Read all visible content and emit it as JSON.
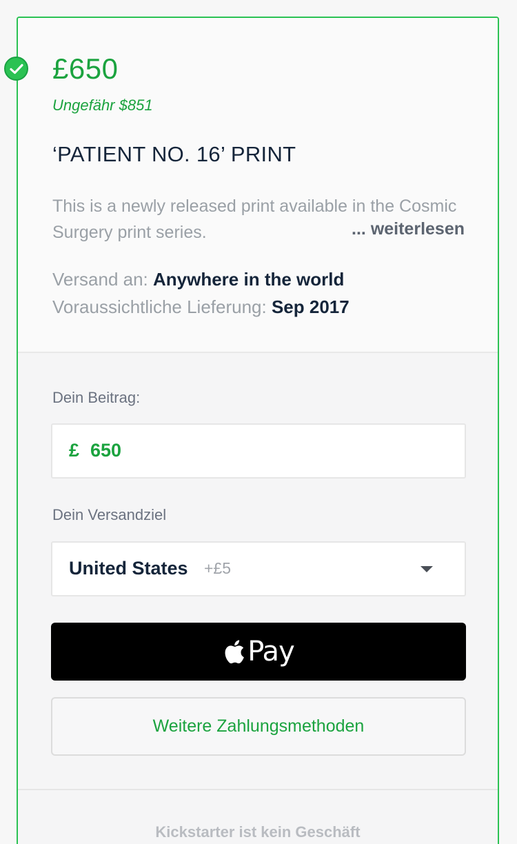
{
  "reward": {
    "price": "£650",
    "approx": "Ungefähr $851",
    "title": "‘PATIENT NO. 16’ PRINT",
    "description": "This is a newly released print available in the Cosmic Surgery print series.",
    "read_more": "... weiterlesen",
    "shipping_label": "Versand an: ",
    "shipping_value": "Anywhere in the world",
    "delivery_label": "Voraussichtliche Lieferung: ",
    "delivery_value": "Sep 2017"
  },
  "pledge": {
    "amount_label": "Dein Beitrag:",
    "currency_symbol": "£",
    "amount_value": "650",
    "destination_label": "Dein Versandziel",
    "destination_value": "United States",
    "destination_surcharge": "+£5",
    "apple_pay_label": "Pay",
    "other_payment_label": "Weitere Zahlungsmethoden"
  },
  "footer": {
    "notice": "Kickstarter ist kein Geschäft"
  },
  "colors": {
    "accent_green": "#1ba33f",
    "border_green": "#2bc253",
    "text_dark": "#15253a"
  },
  "icons": {
    "selected": "check-circle-icon",
    "apple": "apple-logo-icon",
    "dropdown": "caret-down-icon"
  }
}
